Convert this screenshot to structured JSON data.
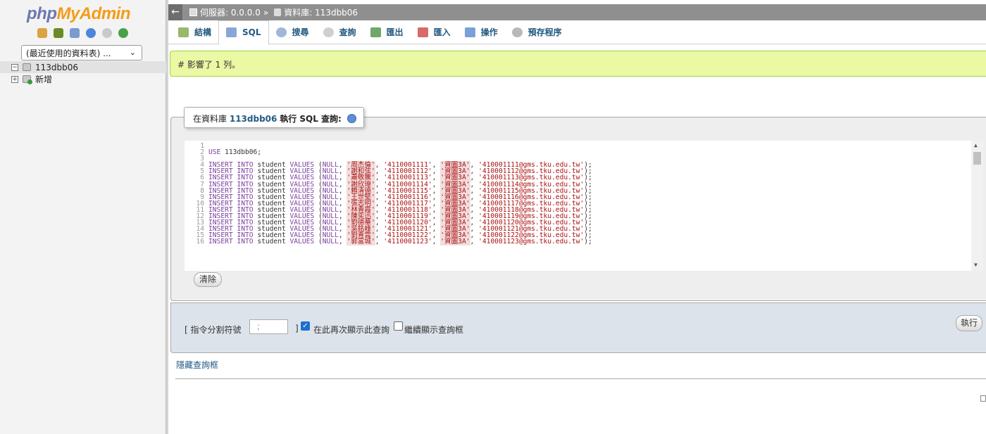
{
  "app": {
    "logo_php": "php",
    "logo_myadmin": "MyAdmin"
  },
  "sidebar": {
    "recent_select": "(最近使用的資料表) ...",
    "tree": [
      {
        "label": "113dbb06",
        "selected": true
      },
      {
        "label": "新增",
        "selected": false
      }
    ],
    "icons": [
      "home-icon",
      "table-icon",
      "sql-icon",
      "docs-icon",
      "settings-icon",
      "reload-icon"
    ]
  },
  "breadcrumb": {
    "server": "伺服器: 0.0.0.0",
    "separator": "»",
    "database": "資料庫: 113dbb06"
  },
  "tabs": [
    {
      "label": "結構",
      "icon": "structure-icon",
      "active": false
    },
    {
      "label": "SQL",
      "icon": "sql-icon",
      "active": true
    },
    {
      "label": "搜尋",
      "icon": "search-icon",
      "active": false
    },
    {
      "label": "查詢",
      "icon": "query-icon",
      "active": false
    },
    {
      "label": "匯出",
      "icon": "export-icon",
      "active": false
    },
    {
      "label": "匯入",
      "icon": "import-icon",
      "active": false
    },
    {
      "label": "操作",
      "icon": "wrench-icon",
      "active": false
    },
    {
      "label": "預存程序",
      "icon": "routines-icon",
      "active": false
    }
  ],
  "notice": "# 影響了 1 列。",
  "query_panel": {
    "legend_prefix": "在資料庫",
    "legend_db": "113dbb06",
    "legend_suffix": "執行 SQL 查詢:",
    "clear_button": "清除",
    "delimiter_label_open": "[ 指令分割符號",
    "delimiter_value": ";",
    "delimiter_label_close": "]",
    "show_again_label": "在此再次顯示此查詢",
    "show_again_checked": true,
    "keep_box_label": "繼續顯示查詢框",
    "keep_box_checked": false,
    "go_button": "執行",
    "hide_link": "隱藏查詢框"
  },
  "sql": {
    "use_stmt": "USE 113dbb06;",
    "table": "student",
    "rows": [
      {
        "line": 4,
        "name": "周杰倫",
        "id": "4110001111",
        "dept": "資圖3A",
        "email": "410001111@gms.tku.edu.tw"
      },
      {
        "line": 5,
        "name": "謝和弦",
        "id": "4110001112",
        "dept": "資圖3A",
        "email": "410001112@gms.tku.edu.tw"
      },
      {
        "line": 6,
        "name": "蕭敬騰",
        "id": "4110001113",
        "dept": "資圖3A",
        "email": "410001113@gms.tku.edu.tw"
      },
      {
        "line": 7,
        "name": "謝欣瑋",
        "id": "4110001114",
        "dept": "資圖3A",
        "email": "410001114@gms.tku.edu.tw"
      },
      {
        "line": 8,
        "name": "賴清德",
        "id": "4110001115",
        "dept": "資圖3A",
        "email": "410001115@gms.tku.edu.tw"
      },
      {
        "line": 9,
        "name": "王世堅",
        "id": "4110001116",
        "dept": "資圖3A",
        "email": "410001116@gms.tku.edu.tw"
      },
      {
        "line": 10,
        "name": "張志明",
        "id": "4110001117",
        "dept": "資圖3A",
        "email": "410001117@gms.tku.edu.tw"
      },
      {
        "line": 11,
        "name": "林青霞",
        "id": "4110001118",
        "dept": "資圖3A",
        "email": "410001118@gms.tku.edu.tw"
      },
      {
        "line": 12,
        "name": "陳奕迅",
        "id": "4110001119",
        "dept": "資圖3A",
        "email": "410001119@gms.tku.edu.tw"
      },
      {
        "line": 13,
        "name": "劉德華",
        "id": "4110001120",
        "dept": "資圖3A",
        "email": "410001120@gms.tku.edu.tw"
      },
      {
        "line": 14,
        "name": "吳銘峰",
        "id": "4110001121",
        "dept": "資圖3A",
        "email": "410001121@gms.tku.edu.tw"
      },
      {
        "line": 15,
        "name": "劉青雲",
        "id": "4110001122",
        "dept": "資圖3A",
        "email": "410001122@gms.tku.edu.tw"
      },
      {
        "line": 16,
        "name": "郭富城",
        "id": "4110001123",
        "dept": "資圖3A",
        "email": "410001123@gms.tku.edu.tw"
      }
    ]
  },
  "colors": {
    "accent_link": "#235a81",
    "notice_bg": "#ebf8a4",
    "notice_border": "#a2d246",
    "breadcrumb_bg": "#8f8f8f"
  }
}
